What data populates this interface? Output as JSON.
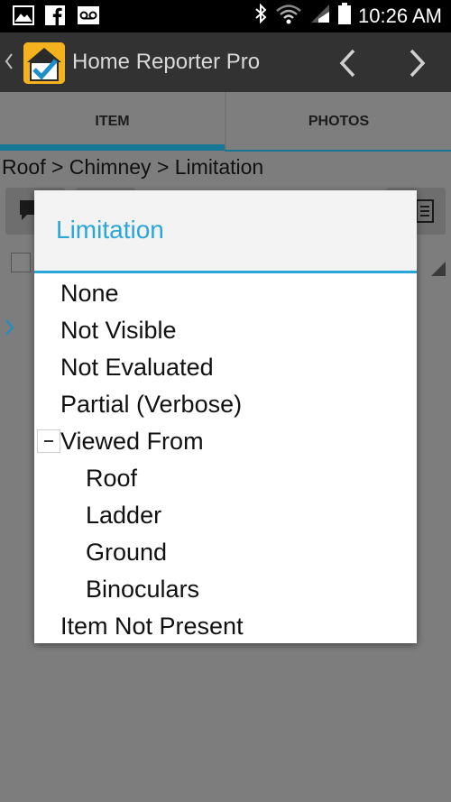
{
  "status_bar": {
    "time": "10:26 AM",
    "icons": [
      "gallery-icon",
      "facebook-icon",
      "voicemail-icon",
      "bluetooth-icon",
      "wifi-icon",
      "signal-icon",
      "battery-icon"
    ]
  },
  "app_bar": {
    "title": "Home Reporter Pro",
    "logo": "checklist-house-logo",
    "nav": [
      "previous-chevron-icon",
      "next-chevron-icon"
    ]
  },
  "tabs": [
    {
      "label": "ITEM",
      "selected": true
    },
    {
      "label": "PHOTOS",
      "selected": false
    }
  ],
  "breadcrumb": "Roof > Chimney > Limitation",
  "colors": {
    "accent": "#2aa7d8",
    "tab_indicator": "#167797",
    "app_logo": "#f5b21f",
    "action_bar": "#323232"
  },
  "dialog": {
    "title": "Limitation",
    "options": [
      {
        "label": "None",
        "level": 0
      },
      {
        "label": "Not Visible",
        "level": 0
      },
      {
        "label": "Not Evaluated",
        "level": 0
      },
      {
        "label": "Partial (Verbose)",
        "level": 0
      },
      {
        "label": "Viewed From",
        "level": 0,
        "expanded": true
      },
      {
        "label": "Roof",
        "level": 1
      },
      {
        "label": "Ladder",
        "level": 1
      },
      {
        "label": "Ground",
        "level": 1
      },
      {
        "label": "Binoculars",
        "level": 1
      },
      {
        "label": "Item Not Present",
        "level": 0
      }
    ]
  }
}
